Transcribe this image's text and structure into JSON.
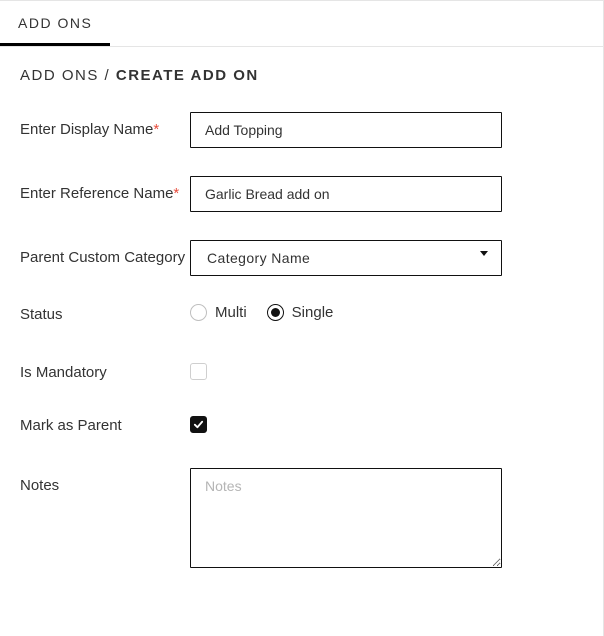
{
  "tabs": {
    "addons": "ADD ONS"
  },
  "breadcrumb": {
    "parent": "ADD ONS",
    "sep": "/",
    "current": "CREATE ADD ON"
  },
  "form": {
    "displayName": {
      "label": "Enter Display Name",
      "value": "Add Topping"
    },
    "referenceName": {
      "label": "Enter Reference Name",
      "value": "Garlic Bread add on"
    },
    "parentCategory": {
      "label": "Parent Custom Category",
      "selected": "Category Name"
    },
    "status": {
      "label": "Status",
      "multi": "Multi",
      "single": "Single",
      "value": "single"
    },
    "mandatory": {
      "label": "Is Mandatory",
      "checked": false
    },
    "parent": {
      "label": "Mark as Parent",
      "checked": true
    },
    "notes": {
      "label": "Notes",
      "placeholder": "Notes",
      "value": ""
    }
  }
}
